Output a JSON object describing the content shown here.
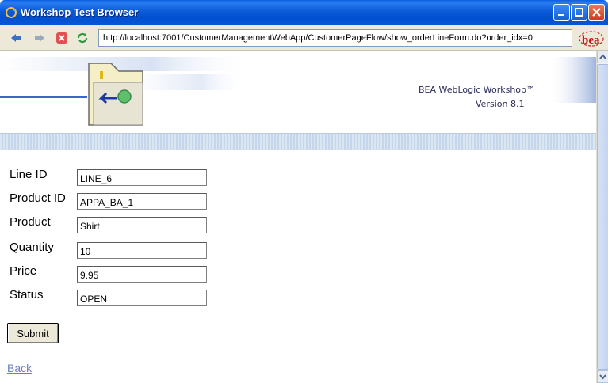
{
  "window": {
    "title": "Workshop Test Browser"
  },
  "toolbar": {
    "url": "http://localhost:7001/CustomerManagementWebApp/CustomerPageFlow/show_orderLineForm.do?order_idx=0",
    "logo_text": "bea"
  },
  "banner": {
    "product_name": "BEA WebLogic Workshop™",
    "version": "Version 8.1"
  },
  "form": {
    "fields": [
      {
        "label": "Line ID",
        "value": "LINE_6"
      },
      {
        "label": "Product ID",
        "value": "APPA_BA_1"
      },
      {
        "label": "Product",
        "value": "Shirt"
      },
      {
        "label": "Quantity",
        "value": "10"
      },
      {
        "label": "Price",
        "value": "9.95"
      },
      {
        "label": "Status",
        "value": "OPEN"
      }
    ],
    "submit_label": "Submit",
    "back_label": "Back"
  },
  "colors": {
    "titlebar": "#0a5fe0",
    "link": "#6a7fc0",
    "stripe": "#c6d6ea"
  }
}
